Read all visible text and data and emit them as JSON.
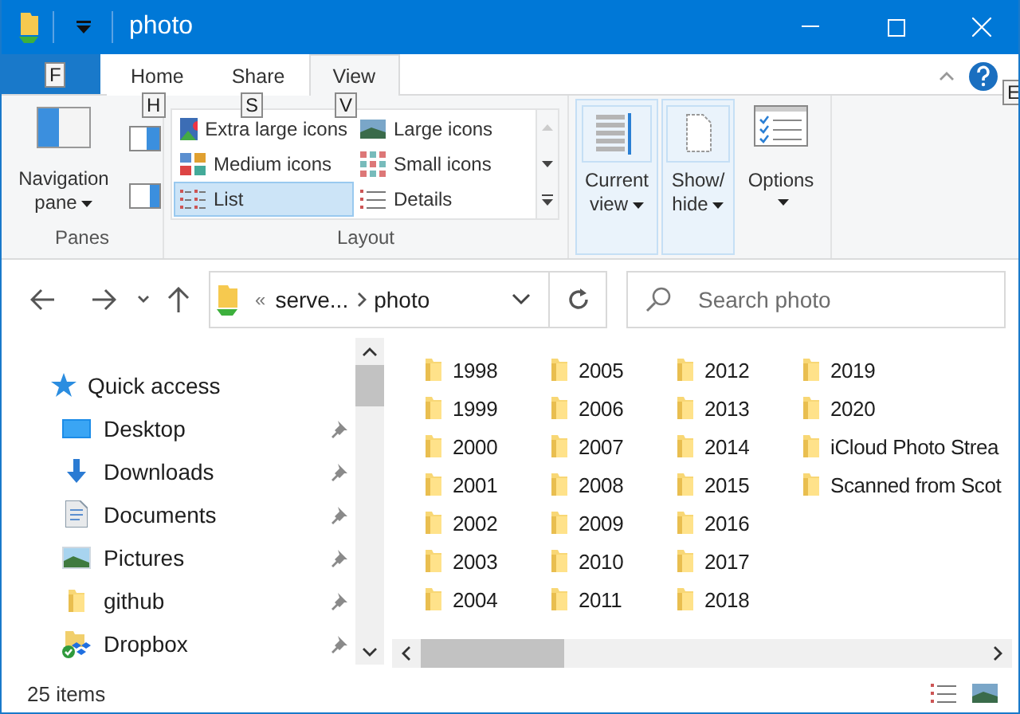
{
  "window": {
    "title": "photo"
  },
  "ribbon": {
    "file_tab": {
      "keytip": "F"
    },
    "tabs": [
      {
        "label": "Home",
        "keytip": "H",
        "selected": false
      },
      {
        "label": "Share",
        "keytip": "S",
        "selected": false
      },
      {
        "label": "View",
        "keytip": "V",
        "selected": true
      }
    ],
    "help_keytip": "E",
    "panes": {
      "label": "Panes",
      "navigation_pane": "Navigation pane"
    },
    "layout": {
      "label": "Layout",
      "options": [
        {
          "label": "Extra large icons",
          "selected": false
        },
        {
          "label": "Large icons",
          "selected": false
        },
        {
          "label": "Medium icons",
          "selected": false
        },
        {
          "label": "Small icons",
          "selected": false
        },
        {
          "label": "List",
          "selected": true
        },
        {
          "label": "Details",
          "selected": false
        }
      ]
    },
    "current_view": "Current view",
    "show_hide": "Show/hide",
    "options": "Options"
  },
  "address": {
    "overflow": "«",
    "segments": [
      "serve...",
      "photo"
    ]
  },
  "search": {
    "placeholder": "Search photo"
  },
  "navigation": {
    "label": "Quick access",
    "children": [
      {
        "label": "Desktop",
        "kind": "desktop",
        "pinned": true
      },
      {
        "label": "Downloads",
        "kind": "downloads",
        "pinned": true
      },
      {
        "label": "Documents",
        "kind": "documents",
        "pinned": true
      },
      {
        "label": "Pictures",
        "kind": "pictures",
        "pinned": true
      },
      {
        "label": "github",
        "kind": "folder",
        "pinned": true
      },
      {
        "label": "Dropbox",
        "kind": "dropbox",
        "pinned": true
      }
    ]
  },
  "files": [
    {
      "name": "1998"
    },
    {
      "name": "1999"
    },
    {
      "name": "2000"
    },
    {
      "name": "2001"
    },
    {
      "name": "2002"
    },
    {
      "name": "2003"
    },
    {
      "name": "2004"
    },
    {
      "name": "2005"
    },
    {
      "name": "2006"
    },
    {
      "name": "2007"
    },
    {
      "name": "2008"
    },
    {
      "name": "2009"
    },
    {
      "name": "2010"
    },
    {
      "name": "2011"
    },
    {
      "name": "2012"
    },
    {
      "name": "2013"
    },
    {
      "name": "2014"
    },
    {
      "name": "2015"
    },
    {
      "name": "2016"
    },
    {
      "name": "2017"
    },
    {
      "name": "2018"
    },
    {
      "name": "2019"
    },
    {
      "name": "2020"
    },
    {
      "name": "iCloud Photo Strea"
    },
    {
      "name": "Scanned from Scot"
    }
  ],
  "status_bar": {
    "item_count": "25 items"
  }
}
